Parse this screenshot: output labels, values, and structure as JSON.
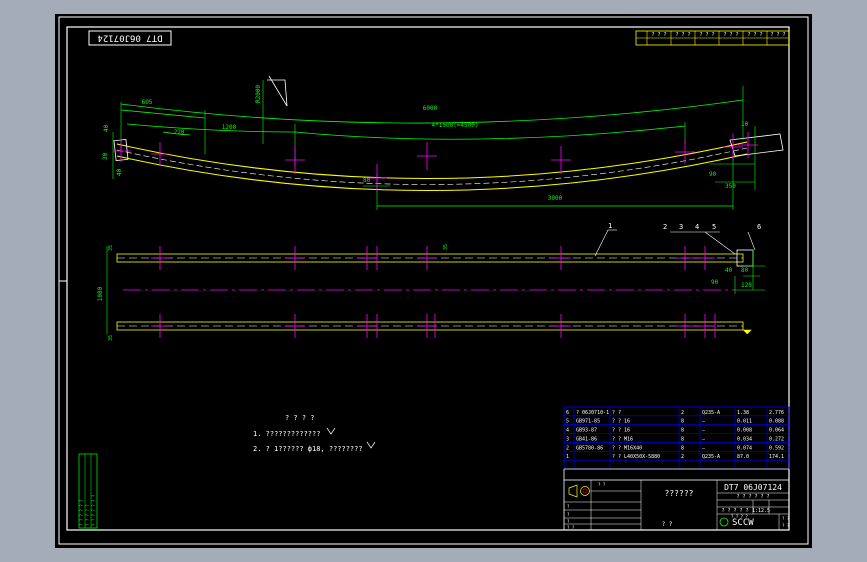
{
  "drawing": {
    "top_code": "DT7 06J07124",
    "title_code": "DT7 06J07124",
    "company": "SCCW",
    "scale_note": "1:12.5",
    "unknown_name": "??????",
    "notes_title": "? ? ? ?",
    "note1": "1. ?????????????",
    "note2": "2. ? 1?????? ф18, ????????"
  },
  "dimensions": {
    "d6000": "6000",
    "d605": "605",
    "d1200": "1200",
    "d220": "220",
    "d47": "4*1500(=4500)",
    "d3000": "3000",
    "dR": "R2000",
    "d40a": "40",
    "d40b": "40",
    "d30": "30",
    "d80": "80",
    "d90": "90",
    "d350": "350",
    "d10": "10",
    "d35a": "35",
    "d35b": "35",
    "d35c": "35",
    "d1080": "1080",
    "d40c": "40",
    "d80b": "80",
    "d120": "120",
    "d90b": "90"
  },
  "balloons": [
    "1",
    "2",
    "3",
    "4",
    "5",
    "6"
  ],
  "bom": [
    {
      "no": "6",
      "code": "? 06J0710-1",
      "name": "? ?",
      "qty": "2",
      "mat": "Q235-A",
      "w1": "1.38",
      "w2": "2.776"
    },
    {
      "no": "5",
      "code": "GB971-85",
      "name": "? ? 16",
      "qty": "8",
      "mat": "—",
      "w1": "0.011",
      "w2": "0.088"
    },
    {
      "no": "4",
      "code": "GB93-87",
      "name": "? ? 16",
      "qty": "8",
      "mat": "—",
      "w1": "0.008",
      "w2": "0.064"
    },
    {
      "no": "3",
      "code": "GB41-86",
      "name": "? ? M16",
      "qty": "8",
      "mat": "—",
      "w1": "0.034",
      "w2": "0.272"
    },
    {
      "no": "2",
      "code": "GB5780-86",
      "name": "? ? M16X40",
      "qty": "8",
      "mat": "—",
      "w1": "0.074",
      "w2": "0.592"
    },
    {
      "no": "1",
      "code": "",
      "name": "? ? L40X50X-5880",
      "qty": "2",
      "mat": "Q235-A",
      "w1": "87.0",
      "w2": "174.1"
    }
  ],
  "title_block": {
    "sheet_labels": [
      "? ?",
      "? ?",
      "? ?",
      "?"
    ],
    "top_right": [
      "? ? ?",
      "? ? ?",
      "? ? ?",
      "? ? ?",
      "? ? ?",
      "? ? ?"
    ],
    "rev_labels": [
      "?",
      "?",
      "?",
      "? ?",
      "?"
    ],
    "check_label": "? ?",
    "stage": "? ? ? ? ? ?",
    "sheet": "? ? ? ? ?",
    "scale_cells": [
      "? ? ? ?",
      "? ?",
      "? ?"
    ]
  },
  "side_stamp": {
    "line1": "? ? ? ? ? ?",
    "line2": "? ? ? ? ?",
    "line3": "? ? ? ? ? ? ?"
  },
  "colors": {
    "background": "#000000",
    "border": "#ffffff",
    "dimension": "#00ff00",
    "member": "#ffff00",
    "bolt": "#ff00ff",
    "table": "#0000ff",
    "note": "#ffffff",
    "balloon": "#ffffff"
  }
}
